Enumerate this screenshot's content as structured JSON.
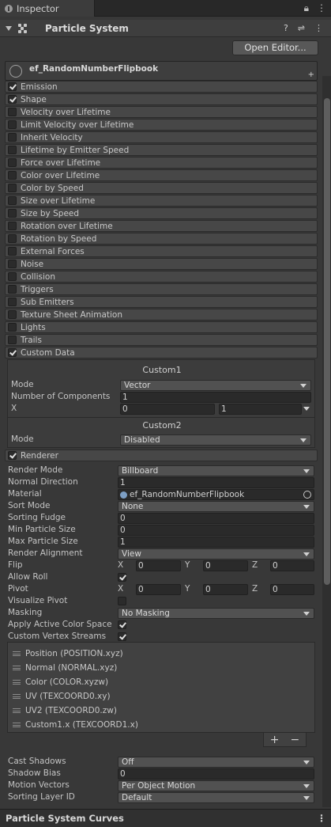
{
  "tab": {
    "title": "Inspector"
  },
  "component": {
    "title": "Particle System",
    "open_editor": "Open Editor..."
  },
  "system": {
    "name": "ef_RandomNumberFlipbook",
    "add": "+"
  },
  "modules": [
    {
      "label": "Emission",
      "enabled": true
    },
    {
      "label": "Shape",
      "enabled": true
    },
    {
      "label": "Velocity over Lifetime",
      "enabled": false
    },
    {
      "label": "Limit Velocity over Lifetime",
      "enabled": false
    },
    {
      "label": "Inherit Velocity",
      "enabled": false
    },
    {
      "label": "Lifetime by Emitter Speed",
      "enabled": false
    },
    {
      "label": "Force over Lifetime",
      "enabled": false
    },
    {
      "label": "Color over Lifetime",
      "enabled": false
    },
    {
      "label": "Color by Speed",
      "enabled": false
    },
    {
      "label": "Size over Lifetime",
      "enabled": false
    },
    {
      "label": "Size by Speed",
      "enabled": false
    },
    {
      "label": "Rotation over Lifetime",
      "enabled": false
    },
    {
      "label": "Rotation by Speed",
      "enabled": false
    },
    {
      "label": "External Forces",
      "enabled": false
    },
    {
      "label": "Noise",
      "enabled": false
    },
    {
      "label": "Collision",
      "enabled": false
    },
    {
      "label": "Triggers",
      "enabled": false
    },
    {
      "label": "Sub Emitters",
      "enabled": false
    },
    {
      "label": "Texture Sheet Animation",
      "enabled": false
    },
    {
      "label": "Lights",
      "enabled": false
    },
    {
      "label": "Trails",
      "enabled": false
    },
    {
      "label": "Custom Data",
      "enabled": true
    }
  ],
  "custom_data": {
    "custom1": {
      "title": "Custom1",
      "mode_label": "Mode",
      "mode_value": "Vector",
      "components_label": "Number of Components",
      "components_value": "1",
      "x_label": "X",
      "x_min": "0",
      "x_max": "1"
    },
    "custom2": {
      "title": "Custom2",
      "mode_label": "Mode",
      "mode_value": "Disabled"
    }
  },
  "renderer": {
    "title": "Renderer",
    "enabled": true,
    "render_mode_label": "Render Mode",
    "render_mode": "Billboard",
    "normal_direction_label": "Normal Direction",
    "normal_direction": "1",
    "material_label": "Material",
    "material": "ef_RandomNumberFlipbook",
    "sort_mode_label": "Sort Mode",
    "sort_mode": "None",
    "sorting_fudge_label": "Sorting Fudge",
    "sorting_fudge": "0",
    "min_size_label": "Min Particle Size",
    "min_size": "0",
    "max_size_label": "Max Particle Size",
    "max_size": "1",
    "alignment_label": "Render Alignment",
    "alignment": "View",
    "flip_label": "Flip",
    "flip": {
      "x": "0",
      "y": "0",
      "z": "0"
    },
    "allow_roll_label": "Allow Roll",
    "allow_roll": true,
    "pivot_label": "Pivot",
    "pivot": {
      "x": "0",
      "y": "0",
      "z": "0"
    },
    "visualize_pivot_label": "Visualize Pivot",
    "visualize_pivot": false,
    "masking_label": "Masking",
    "masking": "No Masking",
    "color_space_label": "Apply Active Color Space",
    "color_space": true,
    "vertex_streams_label": "Custom Vertex Streams",
    "vertex_streams": true,
    "streams": [
      "Position (POSITION.xyz)",
      "Normal (NORMAL.xyz)",
      "Color (COLOR.xyzw)",
      "UV (TEXCOORD0.xy)",
      "UV2 (TEXCOORD0.zw)",
      "Custom1.x (TEXCOORD1.x)"
    ],
    "add": "+",
    "remove": "−",
    "cast_shadows_label": "Cast Shadows",
    "cast_shadows": "Off",
    "shadow_bias_label": "Shadow Bias",
    "shadow_bias": "0",
    "motion_vectors_label": "Motion Vectors",
    "motion_vectors": "Per Object Motion",
    "sorting_layer_label": "Sorting Layer ID",
    "sorting_layer": "Default"
  },
  "xyz_labels": {
    "x": "X",
    "y": "Y",
    "z": "Z"
  },
  "footer": {
    "title": "Particle System Curves"
  }
}
